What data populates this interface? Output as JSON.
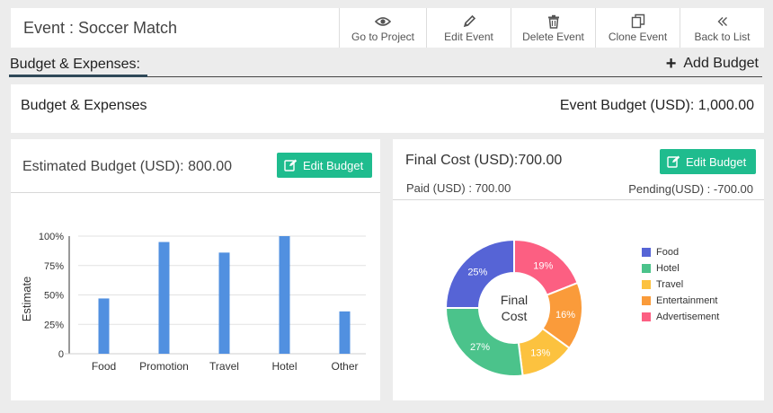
{
  "header": {
    "title": "Event : Soccer Match",
    "actions": [
      {
        "label": "Go to Project",
        "icon": "eye-icon"
      },
      {
        "label": "Edit Event",
        "icon": "pencil-icon"
      },
      {
        "label": "Delete Event",
        "icon": "trash-icon"
      },
      {
        "label": "Clone Event",
        "icon": "copy-icon"
      },
      {
        "label": "Back to List",
        "icon": "double-chevron-left-icon"
      }
    ]
  },
  "section": {
    "title": "Budget & Expenses:",
    "add_label": "Add Budget"
  },
  "summary": {
    "title": "Budget & Expenses",
    "event_budget": "Event Budget (USD): 1,000.00"
  },
  "estimated": {
    "title": "Estimated Budget (USD): 800.00",
    "edit_label": "Edit Budget"
  },
  "final": {
    "title": "Final Cost (USD):700.00",
    "edit_label": "Edit Budget",
    "paid": "Paid (USD) : 700.00",
    "pending": "Pending(USD) : -700.00"
  },
  "colors": {
    "accent_green": "#1fbc8e",
    "bar_blue": "#5190e0"
  },
  "chart_data": [
    {
      "type": "bar",
      "categories": [
        "Food",
        "Promotion",
        "Travel",
        "Hotel",
        "Other"
      ],
      "values": [
        47,
        95,
        86,
        100,
        36
      ],
      "ylabel": "Estimate",
      "ylim": [
        0,
        100
      ],
      "yticks": [
        "0",
        "25%",
        "50%",
        "75%",
        "100%"
      ],
      "grid": true
    },
    {
      "type": "pie",
      "center_label": "Final Cost",
      "slices": [
        {
          "name": "Food",
          "value": 25,
          "label": "25%",
          "color": "#5664d6"
        },
        {
          "name": "Hotel",
          "value": 27,
          "label": "27%",
          "color": "#4bc38b"
        },
        {
          "name": "Travel",
          "value": 13,
          "label": "13%",
          "color": "#fcc23f"
        },
        {
          "name": "Entertainment",
          "value": 16,
          "label": "16%",
          "color": "#fa9b3a"
        },
        {
          "name": "Advertisement",
          "value": 19,
          "label": "19%",
          "color": "#fc5f82"
        }
      ],
      "legend_position": "right"
    }
  ]
}
